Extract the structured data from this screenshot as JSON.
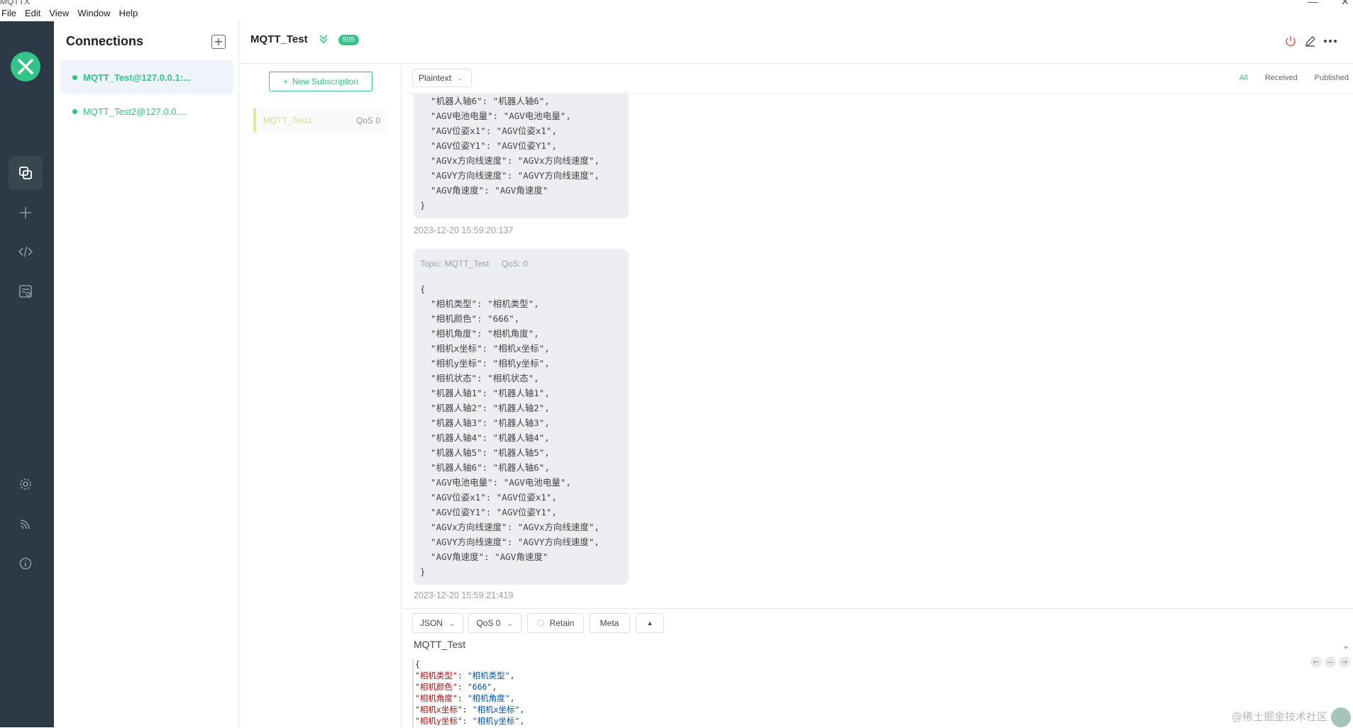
{
  "window": {
    "title": "MQTTX",
    "menu": [
      "File",
      "Edit",
      "View",
      "Window",
      "Help"
    ]
  },
  "sidebar": {
    "logo_icon": "mqttx-logo-icon",
    "items": [
      {
        "icon": "connections-icon",
        "active": true
      },
      {
        "icon": "plus-icon"
      },
      {
        "icon": "code-icon"
      },
      {
        "icon": "log-icon"
      },
      {
        "icon": "settings-icon"
      },
      {
        "icon": "rss-icon"
      },
      {
        "icon": "info-icon"
      }
    ]
  },
  "connections": {
    "title": "Connections",
    "items": [
      {
        "label": "MQTT_Test@127.0.0.1:...",
        "active": true
      },
      {
        "label": "MQTT_Test2@127.0.0...."
      }
    ]
  },
  "header": {
    "name": "MQTT_Test",
    "badge": "505"
  },
  "subscriptions": {
    "new_label": "New Subscription",
    "items": [
      {
        "topic": "MQTT_Test1",
        "qos": "QoS 0"
      }
    ]
  },
  "message_toolbar": {
    "format": "Plaintext",
    "filters": [
      "All",
      "Received",
      "Published"
    ]
  },
  "messages": [
    {
      "lines": [
        "  \"机器人轴6\": \"机器人轴6\",",
        "  \"AGV电池电量\": \"AGV电池电量\",",
        "  \"AGV位姿x1\": \"AGV位姿x1\",",
        "  \"AGV位姿Y1\": \"AGV位姿Y1\",",
        "  \"AGVx方向线速度\": \"AGVx方向线速度\",",
        "  \"AGVY方向线速度\": \"AGVY方向线速度\",",
        "  \"AGV角速度\": \"AGV角速度\"",
        "}"
      ],
      "time": "2023-12-20 15:59:20:137"
    },
    {
      "topic": "Topic: MQTT_Test",
      "qos": "QoS: 0",
      "lines": [
        "{",
        "  \"相机类型\": \"相机类型\",",
        "  \"相机颜色\": \"666\",",
        "  \"相机角度\": \"相机角度\",",
        "  \"相机x坐标\": \"相机x坐标\",",
        "  \"相机y坐标\": \"相机y坐标\",",
        "  \"相机状态\": \"相机状态\",",
        "  \"机器人轴1\": \"机器人轴1\",",
        "  \"机器人轴2\": \"机器人轴2\",",
        "  \"机器人轴3\": \"机器人轴3\",",
        "  \"机器人轴4\": \"机器人轴4\",",
        "  \"机器人轴5\": \"机器人轴5\",",
        "  \"机器人轴6\": \"机器人轴6\",",
        "  \"AGV电池电量\": \"AGV电池电量\",",
        "  \"AGV位姿x1\": \"AGV位姿x1\",",
        "  \"AGV位姿Y1\": \"AGV位姿Y1\",",
        "  \"AGVx方向线速度\": \"AGVx方向线速度\",",
        "  \"AGVY方向线速度\": \"AGVY方向线速度\",",
        "  \"AGV角速度\": \"AGV角速度\"",
        "}"
      ],
      "time": "2023-12-20 15:59:21:419"
    }
  ],
  "publish": {
    "payload_format": "JSON",
    "qos": "QoS 0",
    "retain_label": "Retain",
    "meta_label": "Meta",
    "topic": "MQTT_Test",
    "editor_open": "{",
    "editor_lines": [
      {
        "k": "\"相机类型\"",
        "v": "\"相机类型\""
      },
      {
        "k": "\"相机颜色\"",
        "v": "\"666\""
      },
      {
        "k": "\"相机角度\"",
        "v": "\"相机角度\""
      },
      {
        "k": "\"相机x坐标\"",
        "v": "\"相机x坐标\""
      },
      {
        "k": "\"相机y坐标\"",
        "v": "\"相机y坐标\""
      }
    ]
  },
  "watermark": "@稀土掘金技术社区",
  "colors": {
    "accent": "#34c388",
    "sidebar_bg": "#2b3a46",
    "bubble_bg": "#eceef1"
  }
}
